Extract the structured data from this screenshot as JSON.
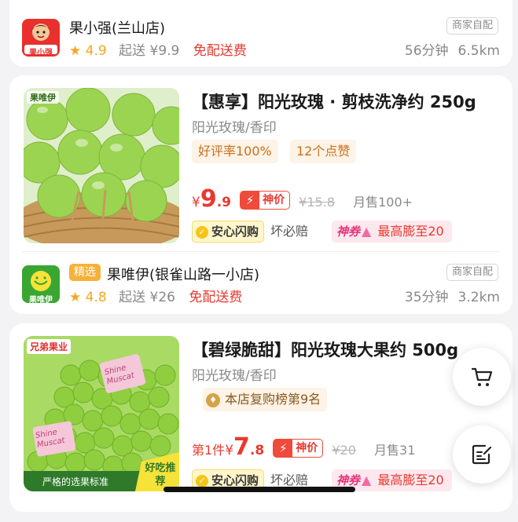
{
  "shop1": {
    "name": "果小强(兰山店)",
    "logo_text": "果小强",
    "rating": "4.9",
    "min_order": "起送 ¥9.9",
    "delivery": "免配送费",
    "merchant_tag": "商家自配",
    "time": "56分钟",
    "distance": "6.5km"
  },
  "product1": {
    "title": "【惠享】阳光玫瑰 · 剪枝洗净约 250g",
    "subtitle": "阳光玫瑰/香印",
    "image_brand": "果唯伊",
    "tags": [
      "好评率100%",
      "12个点赞"
    ],
    "price_currency": "¥",
    "price_int": "9",
    "price_dec": ".9",
    "shenjia_label": "神价",
    "old_price": "¥15.8",
    "sold": "月售100+",
    "anxin_label": "安心闪购",
    "bad_label": "坏必赔",
    "coupon_label": "神券",
    "coupon_text": "最高膨至20"
  },
  "shop2": {
    "badge": "精选",
    "name": "果唯伊(银雀山路一小店)",
    "logo_text": "果唯伊",
    "rating": "4.8",
    "min_order": "起送 ¥26",
    "delivery": "免配送费",
    "merchant_tag": "商家自配",
    "time": "35分钟",
    "distance": "3.2km"
  },
  "product2": {
    "title": "【碧绿脆甜】阳光玫瑰大果约 500g",
    "subtitle": "阳光玫瑰/香印",
    "image_brand": "兄弟果业",
    "image_label1": "Shine Muscat",
    "image_label2": "Shine Muscat",
    "image_caption": "严格的选果标准",
    "image_badge": "好吃推荐",
    "rank_tag": "本店复购榜第9名",
    "first_piece": "第1件",
    "price_currency": "¥",
    "price_int": "7",
    "price_dec": ".8",
    "shenjia_label": "神价",
    "old_price": "¥20",
    "sold": "月售31",
    "anxin_label": "安心闪购",
    "bad_label": "坏必赔",
    "coupon_label": "神券",
    "coupon_text": "最高膨至20"
  },
  "fab": {
    "cart_icon": "cart-icon",
    "edit_icon": "edit-note-icon"
  },
  "colors": {
    "price": "#e8392f",
    "rating": "#f6a623",
    "tag_bg": "#fdf3e6",
    "grape": "#8fce3e"
  }
}
